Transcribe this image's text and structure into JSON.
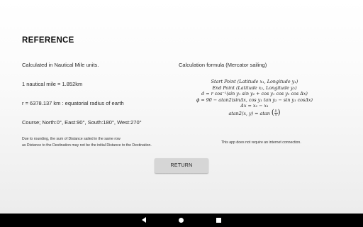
{
  "page": {
    "title": "REFERENCE",
    "units_note": "Calculated in Nautical Mile units.",
    "nautical_mile": "1 nautical mile = 1.852km",
    "earth_radius": "r = 6378.137 km : equatorial radius of earth",
    "course": "Course; North:0°, East:90°, South:180°, West:270°",
    "rounding_note_1": "Due to rounding, the sum of Distance sailed in the same row",
    "rounding_note_2": "as Distance to the Destination may not be the initial Distance to the Destination.",
    "formula_title": "Calculation formula (Mercator sailing)",
    "internet_note": "This app does not require an internet connection.",
    "return_label": "RETURN"
  },
  "formula": {
    "start": "Start Point (Latitude x₁, Longitude y₁)",
    "end": "End Point (Latitude x₂, Longitude y₂)",
    "distance": "d = r cos⁻¹(sin y₁ sin y₂ + cos y₁ cos y₂ cos Δx)",
    "bearing": "ϕ = 90 − atan2(sinΔx, cos y₁ tan y₂ − sin y₁ cosΔx)",
    "delta": "Δx = x₂ − x₁",
    "atan2_lhs": "atan2(x, y) = atan",
    "atan2_num": "y",
    "atan2_den": "x"
  },
  "navbar": {
    "back_icon": "back-triangle-icon",
    "home_icon": "home-circle-icon",
    "recents_icon": "recents-square-icon"
  }
}
